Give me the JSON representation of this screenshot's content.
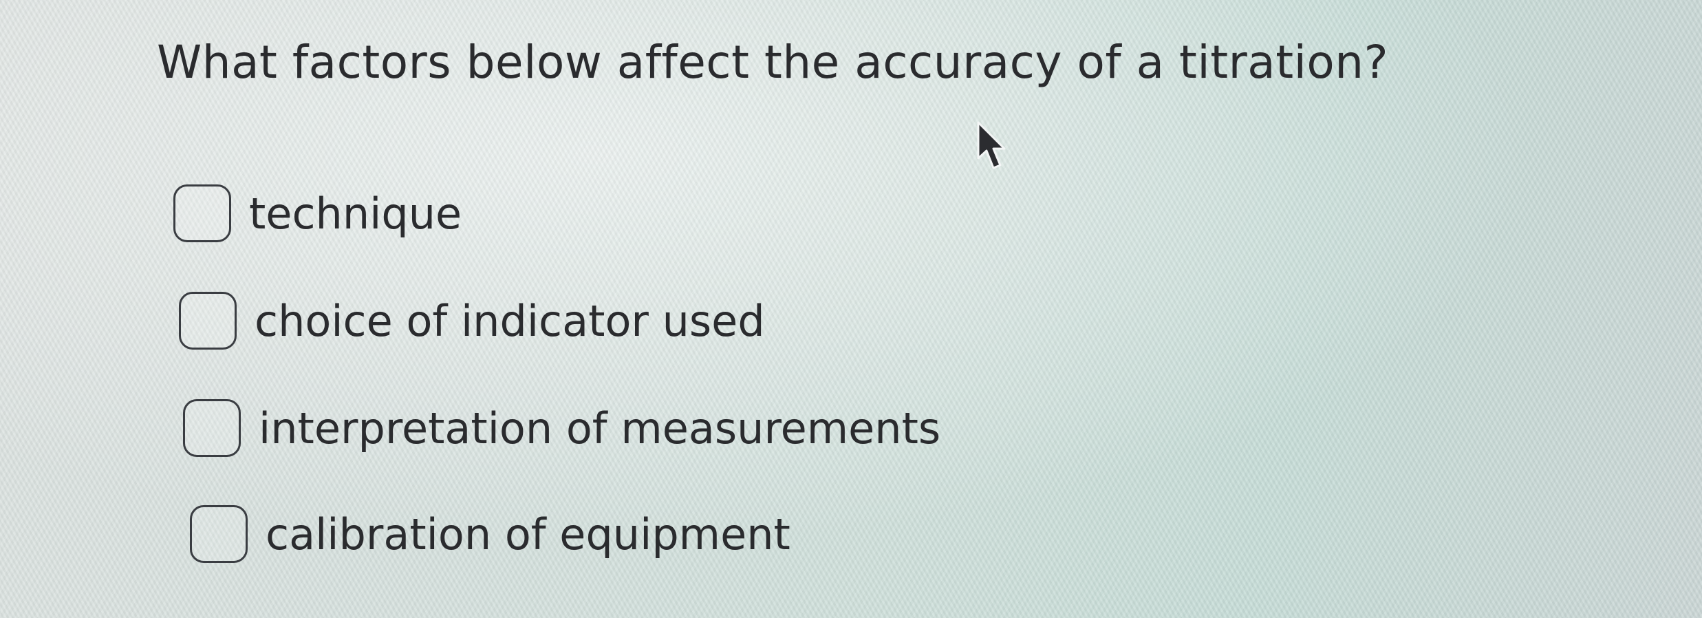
{
  "question": {
    "text": "What factors below affect the accuracy of a titration?"
  },
  "options": [
    {
      "label": "technique",
      "checked": false
    },
    {
      "label": "choice of indicator used",
      "checked": false
    },
    {
      "label": "interpretation of measurements",
      "checked": false
    },
    {
      "label": "calibration of equipment",
      "checked": false
    }
  ],
  "icons": {
    "cursor": "mouse-pointer-icon"
  },
  "colors": {
    "text": "#2a2b2e",
    "checkbox_border": "#3a3d42",
    "background": "#d6e1de"
  }
}
